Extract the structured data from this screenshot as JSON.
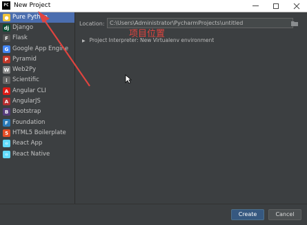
{
  "window": {
    "title": "New Project",
    "app_icon": "PC"
  },
  "sidebar": {
    "items": [
      {
        "label": "Pure Python",
        "icon": "python-icon",
        "color": "#f0c43a",
        "glyph": "●",
        "selected": true
      },
      {
        "label": "Django",
        "icon": "django-icon",
        "color": "#0c4b33",
        "glyph": "dj"
      },
      {
        "label": "Flask",
        "icon": "flask-icon",
        "color": "#555555",
        "glyph": "F"
      },
      {
        "label": "Google App Engine",
        "icon": "google-app-engine-icon",
        "color": "#4285f4",
        "glyph": "G"
      },
      {
        "label": "Pyramid",
        "icon": "pyramid-icon",
        "color": "#c0392b",
        "glyph": "P"
      },
      {
        "label": "Web2Py",
        "icon": "web2py-icon",
        "color": "#888888",
        "glyph": "W"
      },
      {
        "label": "Scientific",
        "icon": "scientific-icon",
        "color": "#666666",
        "glyph": "⁞"
      },
      {
        "label": "Angular CLI",
        "icon": "angular-cli-icon",
        "color": "#dd1b16",
        "glyph": "A"
      },
      {
        "label": "AngularJS",
        "icon": "angularjs-icon",
        "color": "#b52e31",
        "glyph": "A"
      },
      {
        "label": "Bootstrap",
        "icon": "bootstrap-icon",
        "color": "#563d7c",
        "glyph": "B"
      },
      {
        "label": "Foundation",
        "icon": "foundation-icon",
        "color": "#2a7ab8",
        "glyph": "F"
      },
      {
        "label": "HTML5 Boilerplate",
        "icon": "html5-icon",
        "color": "#e44d26",
        "glyph": "5"
      },
      {
        "label": "React App",
        "icon": "react-icon",
        "color": "#61dafb",
        "glyph": "⚛"
      },
      {
        "label": "React Native",
        "icon": "react-native-icon",
        "color": "#61dafb",
        "glyph": "⚛"
      }
    ]
  },
  "main": {
    "location_label": "Location:",
    "location_value": "C:\\Users\\Administrator\\PycharmProjects\\untitled",
    "annotation": "项目位置",
    "interpreter_label": "Project Interpreter: New Virtualenv environment"
  },
  "buttons": {
    "create": "Create",
    "cancel": "Cancel"
  },
  "colors": {
    "accent": "#4b6eaf",
    "annotation": "#e0443f",
    "background": "#3c3f41"
  }
}
